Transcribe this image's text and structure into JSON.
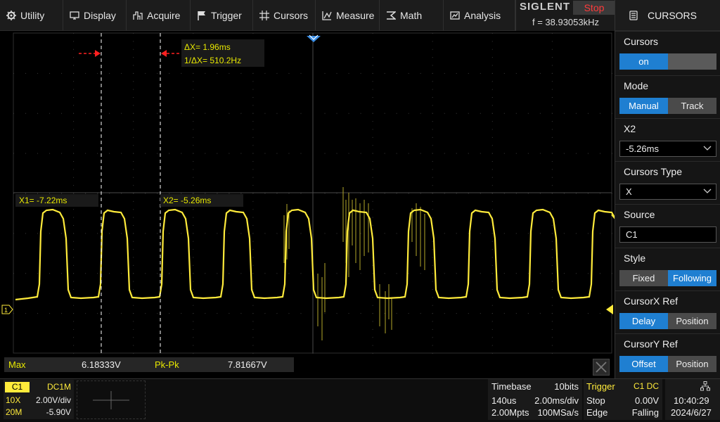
{
  "menu": {
    "utility": "Utility",
    "display": "Display",
    "acquire": "Acquire",
    "trigger": "Trigger",
    "cursors": "Cursors",
    "measure": "Measure",
    "math": "Math",
    "analysis": "Analysis"
  },
  "brand": {
    "logo": "SIGLENT",
    "status": "Stop",
    "freq": "f = 38.93053kHz"
  },
  "panel": {
    "title": "CURSORS",
    "cursors": {
      "label": "Cursors",
      "on": "on",
      "off": ""
    },
    "mode": {
      "label": "Mode",
      "manual": "Manual",
      "track": "Track"
    },
    "x2": {
      "label": "X2",
      "value": "-5.26ms"
    },
    "type": {
      "label": "Cursors Type",
      "value": "X"
    },
    "source": {
      "label": "Source",
      "value": "C1"
    },
    "style": {
      "label": "Style",
      "fixed": "Fixed",
      "following": "Following"
    },
    "cursorx_ref": {
      "label": "CursorX Ref",
      "delay": "Delay",
      "position": "Position"
    },
    "cursory_ref": {
      "label": "CursorY Ref",
      "offset": "Offset",
      "position": "Position"
    }
  },
  "readout": {
    "delta_x": "ΔX= 1.96ms",
    "inv_delta_x": "1/ΔX= 510.2Hz",
    "x1": "X1= -7.22ms",
    "x2": "X2= -5.26ms"
  },
  "measure": {
    "max_label": "Max",
    "max_value": "6.18333V",
    "pkpk_label": "Pk-Pk",
    "pkpk_value": "7.81667V"
  },
  "channel": {
    "name": "C1",
    "coupling": "DC1M",
    "probe": "10X",
    "scale": "2.00V/div",
    "bw": "20M",
    "offset": "-5.90V"
  },
  "timebase": {
    "label": "Timebase",
    "bits": "10bits",
    "delay": "140us",
    "scale": "2.00ms/div",
    "points": "2.00Mpts",
    "rate": "100MSa/s"
  },
  "trigger": {
    "label": "Trigger",
    "source": "C1 DC",
    "state": "Stop",
    "level": "0.00V",
    "type": "Edge",
    "slope": "Falling"
  },
  "clock": {
    "time": "10:40:29",
    "date": "2024/6/27"
  },
  "colors": {
    "trace": "#ffeb3b",
    "cursor": "#ffffff",
    "marker": "#ff2020",
    "accent": "#1f7fd1"
  }
}
